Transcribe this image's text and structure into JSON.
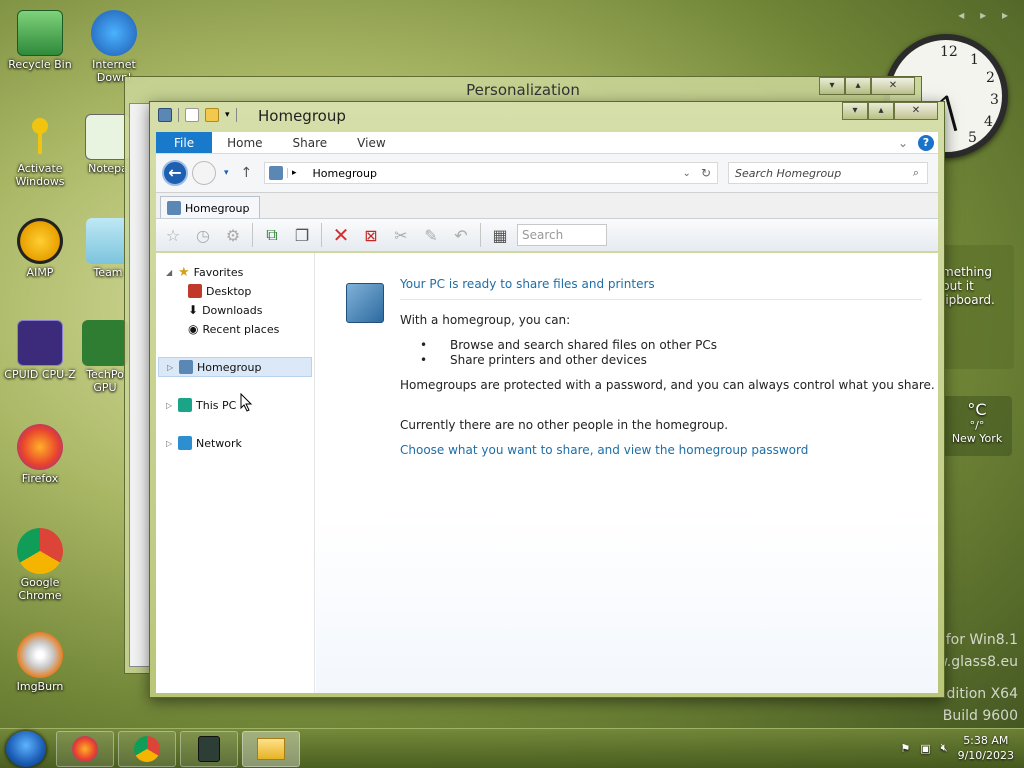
{
  "desktop": {
    "icons": [
      {
        "label": "Recycle Bin"
      },
      {
        "label": "Internet Downl"
      },
      {
        "label": "Activate Windows"
      },
      {
        "label": "Notepa"
      },
      {
        "label": "AIMP"
      },
      {
        "label": "Team"
      },
      {
        "label": "CPUID CPU-Z"
      },
      {
        "label": "TechPo GPU"
      },
      {
        "label": "Firefox"
      },
      {
        "label": "Google Chrome"
      },
      {
        "label": "ImgBurn"
      }
    ],
    "clock_numbers": [
      "12",
      "1",
      "2",
      "3",
      "4",
      "5"
    ],
    "note_text": "mething\n put it\nlipboard.",
    "weather": {
      "unit": "°C",
      "range": "°/°",
      "city": "New York"
    },
    "watermark": {
      "line1": "for Win8.1",
      "line2": "w.glass8.eu",
      "line3": "dition X64",
      "line4": "Build 9600"
    }
  },
  "back_window": {
    "title": "Personalization"
  },
  "window": {
    "title": "Homegroup",
    "ribbon_tabs": [
      "File",
      "Home",
      "Share",
      "View"
    ],
    "address": "Homegroup",
    "search_placeholder": "Search Homegroup",
    "doc_tab": "Homegroup",
    "toolbar_search": "Search",
    "nav": {
      "favorites": "Favorites",
      "desktop": "Desktop",
      "downloads": "Downloads",
      "recent": "Recent places",
      "homegroup": "Homegroup",
      "this_pc": "This PC",
      "network": "Network"
    },
    "content": {
      "heading": "Your PC is ready to share files and printers",
      "intro": "With a homegroup, you can:",
      "bullets": [
        "Browse and search shared files on other PCs",
        "Share printers and other devices"
      ],
      "protected": "Homegroups are protected with a password, and you can always control what you share.",
      "no_people": "Currently there are no other people in the homegroup.",
      "link": "Choose what you want to share, and view the homegroup password"
    }
  },
  "taskbar": {
    "time": "5:38 AM",
    "date": "9/10/2023"
  }
}
